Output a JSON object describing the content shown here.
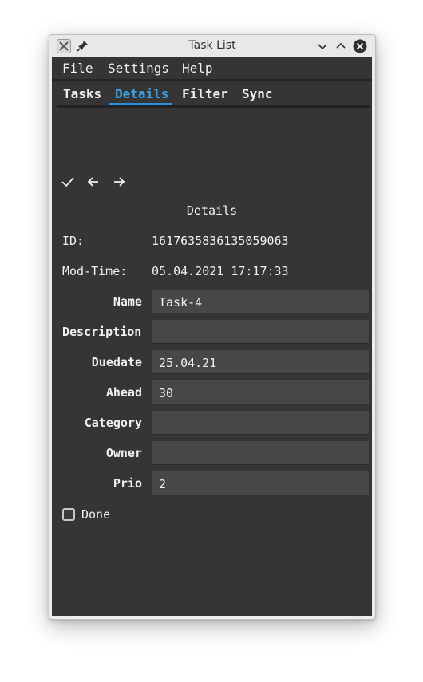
{
  "window": {
    "title": "Task List"
  },
  "menubar": {
    "items": [
      "File",
      "Settings",
      "Help"
    ]
  },
  "tabs": [
    {
      "label": "Tasks",
      "active": false
    },
    {
      "label": "Details",
      "active": true
    },
    {
      "label": "Filter",
      "active": false
    },
    {
      "label": "Sync",
      "active": false
    }
  ],
  "toolbar": {
    "icons": [
      "checkmark-icon",
      "arrow-left-icon",
      "arrow-right-icon"
    ]
  },
  "details": {
    "title": "Details",
    "id_label": "ID:",
    "id_value": "1617635836135059063",
    "modtime_label": "Mod-Time:",
    "modtime_value": "05.04.2021 17:17:33"
  },
  "fields": {
    "name": {
      "label": "Name",
      "value": "Task-4"
    },
    "description": {
      "label": "Description",
      "value": ""
    },
    "duedate": {
      "label": "Duedate",
      "value": "25.04.21"
    },
    "ahead": {
      "label": "Ahead",
      "value": "30"
    },
    "category": {
      "label": "Category",
      "value": ""
    },
    "owner": {
      "label": "Owner",
      "value": ""
    },
    "prio": {
      "label": "Prio",
      "value": "2"
    }
  },
  "done": {
    "label": "Done",
    "checked": false
  },
  "colors": {
    "accent": "#3aa0e8",
    "background": "#353535",
    "field": "#474747"
  }
}
